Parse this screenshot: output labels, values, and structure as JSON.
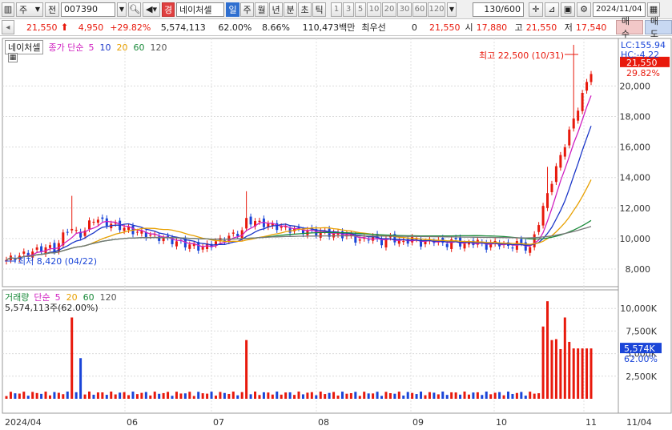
{
  "toolbar": {
    "market": "주",
    "prev_label": "전",
    "code": "007390",
    "stock_badge": "경",
    "stock_name": "네이처셀",
    "periods": [
      "일",
      "주",
      "월",
      "년",
      "분",
      "초",
      "틱"
    ],
    "active_period": "일",
    "intervals": [
      "1",
      "3",
      "5",
      "10",
      "20",
      "30",
      "60",
      "120"
    ],
    "count": "130",
    "count_total": "/600",
    "date": "2024/11/04"
  },
  "quote": {
    "price": "21,550",
    "change": "4,950",
    "change_pct": "+29.82%",
    "volume": "5,574,113",
    "vol_ratio": "62.00%",
    "turnover": "8.66%",
    "amount": "110,473백만",
    "pref_label": "최우선",
    "pref_value": "0",
    "current": "21,550",
    "open_label": "시",
    "open": "17,880",
    "high_label": "고",
    "high": "21,550",
    "low_label": "저",
    "low": "17,540",
    "buy_label": "매수",
    "sell_label": "매도"
  },
  "price_panel": {
    "stock_label": "네이처셀",
    "ma_label": "종가 단순",
    "ma_periods": [
      "5",
      "10",
      "20",
      "60",
      "120"
    ],
    "ma_colors": [
      "#d020c0",
      "#1a36c8",
      "#e8a000",
      "#1a8a3a",
      "#555555"
    ],
    "lc": "LC:155.94",
    "hc": "HC:-4.22",
    "last_price": "21,550",
    "last_pct": "29.82%",
    "high_note": "최고 22,500 (10/31)",
    "low_note": "최저 8,420 (04/22)",
    "y_ticks": [
      "20,000",
      "18,000",
      "16,000",
      "14,000",
      "12,000",
      "10,000",
      "8,000"
    ]
  },
  "volume_panel": {
    "title": "거래량",
    "ma_label": "단순",
    "ma_periods": [
      "5",
      "20",
      "60",
      "120"
    ],
    "value_text": "5,574,113주(62.00%)",
    "last_value": "5,574K",
    "last_pct": "62.00%",
    "y_ticks": [
      "10,000K",
      "7,500K",
      "5,000K",
      "2,500K"
    ]
  },
  "x_axis": {
    "labels": [
      "2024/04",
      "06",
      "07",
      "08",
      "09",
      "10",
      "11",
      "11/04"
    ]
  },
  "colors": {
    "up": "#e8190c",
    "down": "#1a45d8",
    "grid": "#d8d8d8"
  }
}
